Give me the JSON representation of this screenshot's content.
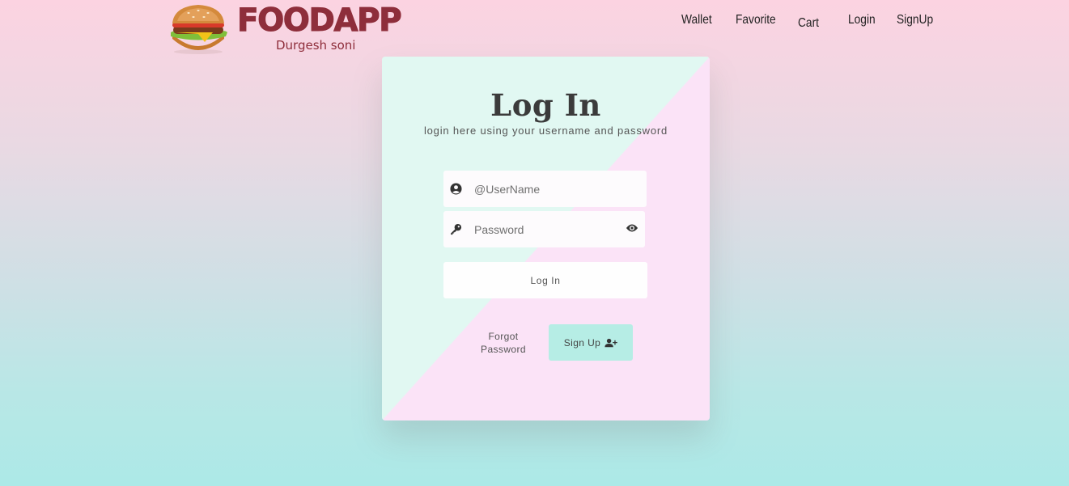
{
  "header": {
    "brand": "FOODAPP",
    "brand_sub": "Durgesh soni",
    "nav": [
      "Wallet",
      "Favorite",
      "Cart",
      "Login",
      "SignUp"
    ]
  },
  "login_card": {
    "title": "Log In",
    "subtitle": "login here using your username and password",
    "username_placeholder": "@UserName",
    "password_placeholder": "Password",
    "login_button": "Log In",
    "forgot_password": "Forgot Password",
    "signup_button": "Sign Up"
  },
  "icons": {
    "username": "user-circle-icon",
    "password": "key-icon",
    "toggle_password": "eye-icon",
    "signup": "user-plus-icon",
    "logo": "burger-icon"
  },
  "colors": {
    "brand": "#8e2e3b",
    "card_mint": "#e1f8f2",
    "card_pink": "#fbe3f7",
    "signup_button": "#b6ede5"
  }
}
